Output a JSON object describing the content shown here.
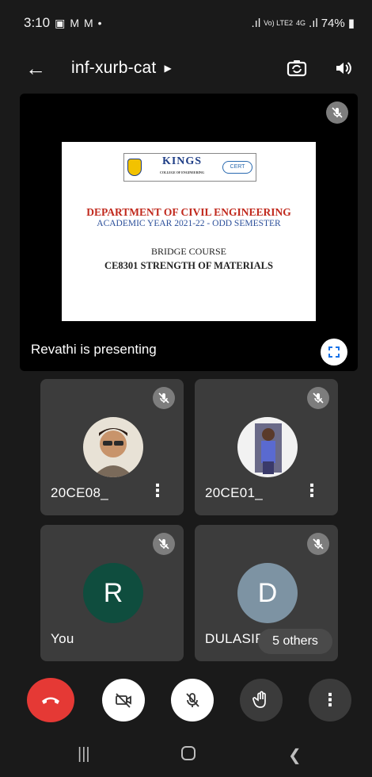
{
  "status_bar": {
    "time": "3:10",
    "network": "Vo) LTE2",
    "network_gen": "4G",
    "battery": "74%"
  },
  "app_bar": {
    "meeting_code": "inf-xurb-cat"
  },
  "presentation": {
    "label": "Revathi is presenting",
    "slide": {
      "logo_text": "KINGS",
      "logo_subtext": "COLLEGE OF ENGINEERING",
      "cert_text": "CERT",
      "department": "DEPARTMENT OF CIVIL ENGINEERING",
      "academic_year": "ACADEMIC YEAR 2021-22 - ODD SEMESTER",
      "course_type": "BRIDGE COURSE",
      "course_name": "CE8301 STRENGTH OF MATERIALS"
    }
  },
  "participants": [
    {
      "name": "20CE08_",
      "avatar_type": "photo",
      "muted": true
    },
    {
      "name": "20CE01_",
      "avatar_type": "photo",
      "muted": true
    },
    {
      "name": "You",
      "initial": "R",
      "avatar_color": "#0f4d3e",
      "muted": true
    },
    {
      "name": "DULASIR",
      "initial": "D",
      "avatar_color": "#7d93a3",
      "muted": true
    }
  ],
  "others_pill": "5 others",
  "colors": {
    "end_call": "#e53935",
    "tile_bg": "#3c3c3c",
    "background": "#1a1a1a"
  }
}
